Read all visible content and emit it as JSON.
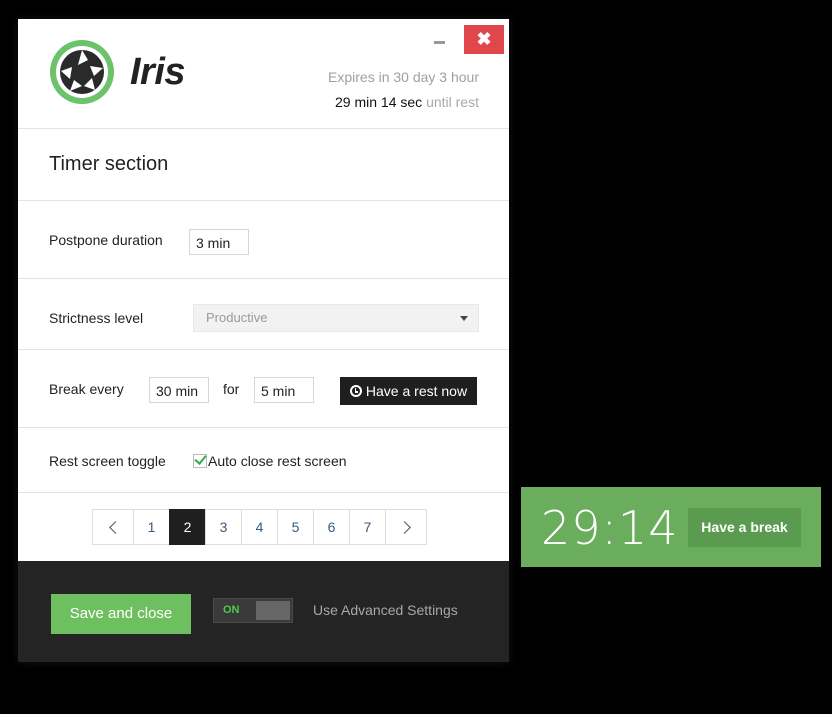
{
  "app": {
    "name": "Iris",
    "brand_color": "#5cb85c"
  },
  "window_controls": {
    "minimize_icon": "minimize-icon",
    "close_symbol": "✖"
  },
  "status": {
    "expires": "Expires in 30 day 3 hour",
    "time_left": "29 min 14 sec",
    "until_text": " until rest"
  },
  "section_title": "Timer section",
  "postpone": {
    "label": "Postpone duration",
    "value": "3 min"
  },
  "strictness": {
    "label": "Strictness level",
    "selected": "Productive"
  },
  "break": {
    "label": "Break every",
    "every_value": "30 min",
    "for_label": "for",
    "for_value": "5 min",
    "rest_button": "Have a rest now"
  },
  "rest_screen": {
    "label": "Rest screen toggle",
    "checkbox_label": "Auto close rest screen",
    "checked": true
  },
  "pagination": {
    "pages": [
      "1",
      "2",
      "3",
      "4",
      "5",
      "6",
      "7"
    ],
    "active": "2"
  },
  "footer": {
    "save_button": "Save and close",
    "toggle_state": "ON",
    "advanced_label": "Use Advanced Settings"
  },
  "widget": {
    "time": "29:14",
    "button": "Have a break",
    "color": "#6aae5d"
  }
}
